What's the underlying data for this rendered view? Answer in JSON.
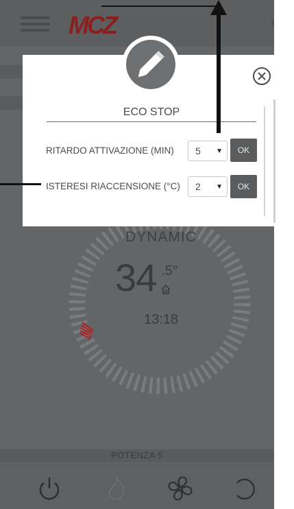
{
  "app": {
    "brand": "MCZ"
  },
  "header": {
    "menu_icon": "hamburger-icon",
    "status_icon": "snowflake-icon"
  },
  "dashboard": {
    "mode": "DYNAMIC",
    "temperature_int": "34",
    "temperature_dec": ".5°",
    "time": "13:18",
    "power_label": "POTENZA 5"
  },
  "bottom_bar": {
    "icons": [
      "power-icon",
      "flame-icon",
      "fan-icon",
      "refresh-icon"
    ]
  },
  "modal": {
    "title": "ECO STOP",
    "rows": [
      {
        "label": "RITARDO ATTIVAZIONE (MIN)",
        "value": "5",
        "ok_label": "OK"
      },
      {
        "label": "ISTERESI RIACCENSIONE (°C)",
        "value": "2",
        "ok_label": "OK"
      }
    ]
  },
  "colors": {
    "brand_red": "#8b1f1f",
    "background_gray": "#646566",
    "ok_button": "#5b5c5d"
  }
}
